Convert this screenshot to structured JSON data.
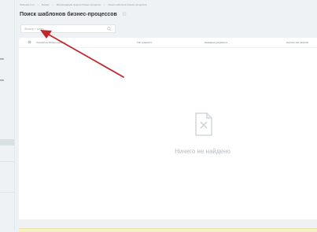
{
  "breadcrumb": [
    "Рабочий стол",
    "Бизнес",
    "Рекомендации модели бизнес-процессы",
    "Поиск шаблонов бизнес-процессов"
  ],
  "page": {
    "title": "Поиск шаблонов бизнес-процессов"
  },
  "search": {
    "placeholder": "Фильтр + поиск",
    "value": ""
  },
  "table": {
    "columns": [
      "Ссылка на бизнес-процесс",
      "Тип сущности",
      "Название документа",
      "Количество записей"
    ]
  },
  "empty_state": {
    "message": "Ничего не найдено"
  },
  "colors": {
    "annotation_arrow": "#c0272d",
    "accent_bg": "#eef2f4"
  }
}
